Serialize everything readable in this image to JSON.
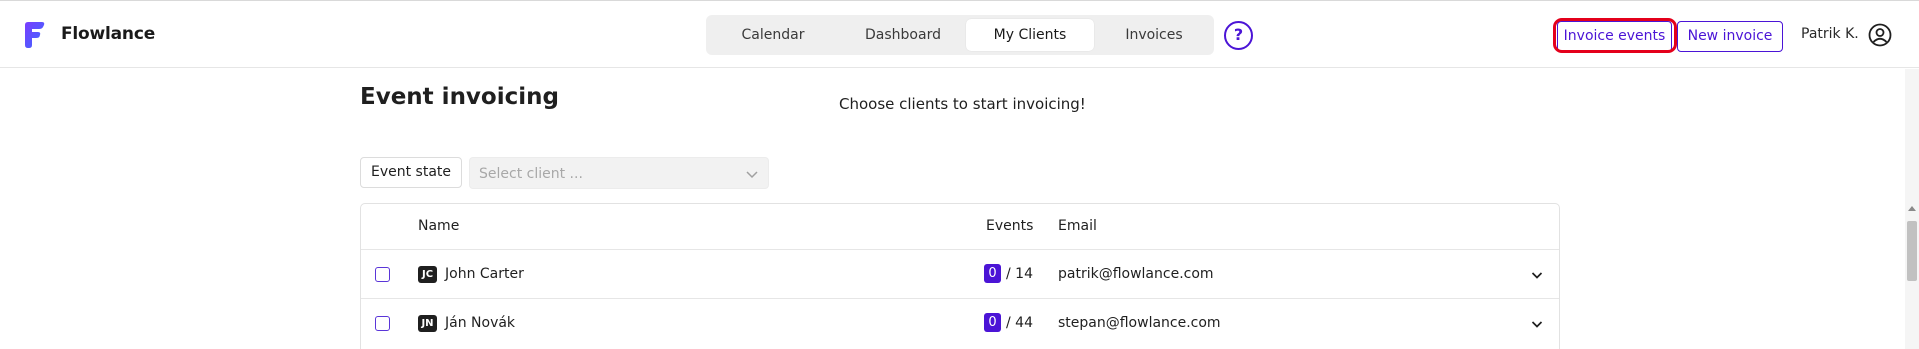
{
  "app": {
    "name": "Flowlance",
    "brand_color": "#4b14d6",
    "logo_icon": "flowlance-logo-icon"
  },
  "nav": {
    "tabs": [
      {
        "label": "Calendar",
        "active": false
      },
      {
        "label": "Dashboard",
        "active": false
      },
      {
        "label": "My Clients",
        "active": true
      },
      {
        "label": "Invoices",
        "active": false
      }
    ],
    "help_label": "?"
  },
  "header": {
    "invoice_events_label": "Invoice events",
    "new_invoice_label": "New invoice",
    "user_name": "Patrik K.",
    "user_icon": "user-circle-icon",
    "highlight_color": "#e4001b"
  },
  "page": {
    "title": "Event invoicing",
    "subtitle": "Choose clients to start invoicing!"
  },
  "filters": {
    "event_state_label": "Event state",
    "client_select_placeholder": "Select client ..."
  },
  "table": {
    "columns": {
      "name": "Name",
      "events": "Events",
      "email": "Email"
    },
    "rows": [
      {
        "initials": "JC",
        "name": "John Carter",
        "selected_events": "0",
        "total_events": "/ 14",
        "email": "patrik@flowlance.com",
        "checked": false
      },
      {
        "initials": "JN",
        "name": "Ján Novák",
        "selected_events": "0",
        "total_events": "/ 44",
        "email": "stepan@flowlance.com",
        "checked": false
      }
    ]
  }
}
